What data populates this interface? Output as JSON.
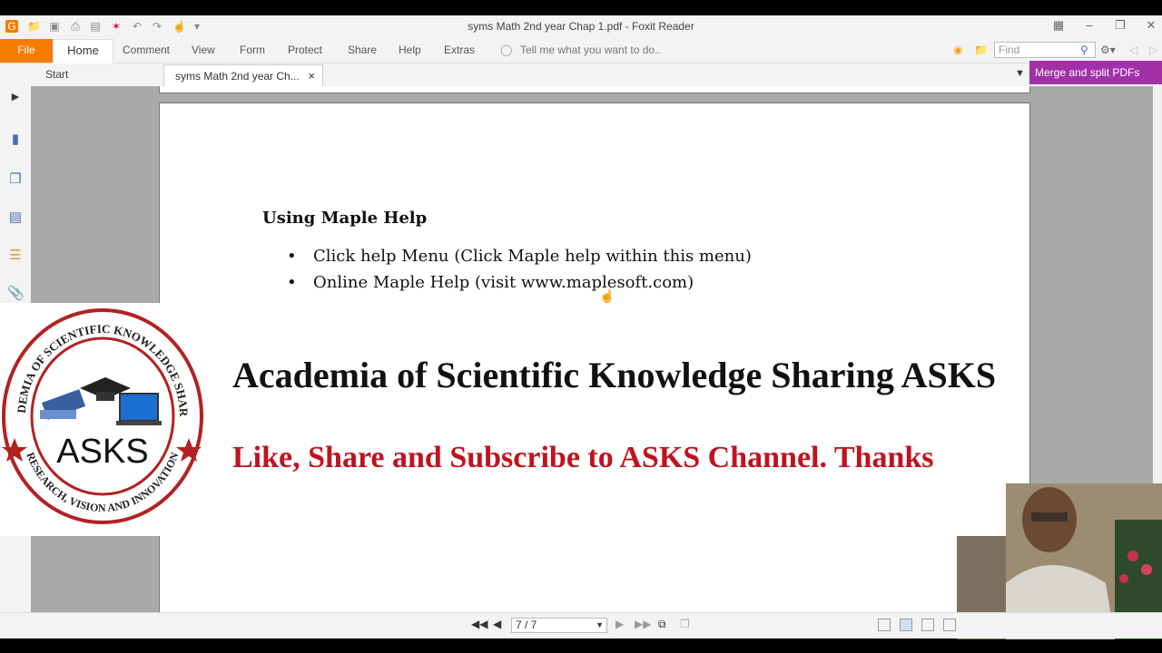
{
  "window": {
    "title": "syms Math 2nd year Chap 1.pdf - Foxit Reader"
  },
  "ribbon": {
    "tabs": [
      "File",
      "Home",
      "Comment",
      "View",
      "Form",
      "Protect",
      "Share",
      "Help",
      "Extras"
    ],
    "tell_me": "Tell me what you want to do..",
    "find_placeholder": "Find"
  },
  "doc_tabs": {
    "start": "Start",
    "active": "syms Math 2nd year Ch...",
    "close": "×"
  },
  "merge_button": "Merge and split PDFs",
  "page": {
    "heading": "Using Maple Help",
    "bullets": [
      "Click help Menu (Click Maple help within this menu)",
      "Online Maple Help (visit www.maplesoft.com)"
    ]
  },
  "banner": {
    "title": "Academia of Scientific Knowledge Sharing ASKS",
    "subtitle": "Like, Share and Subscribe to ASKS Channel. Thanks",
    "logo_text": "ASKS",
    "logo_ring_top": "ACADEMIA OF SCIENTIFIC KNOWLEDGE SHARING",
    "logo_ring_bottom": "RESEARCH, VISION AND INNOVATION",
    "accent_color": "#c1121f"
  },
  "statusbar": {
    "page_indicator": "7 / 7"
  }
}
